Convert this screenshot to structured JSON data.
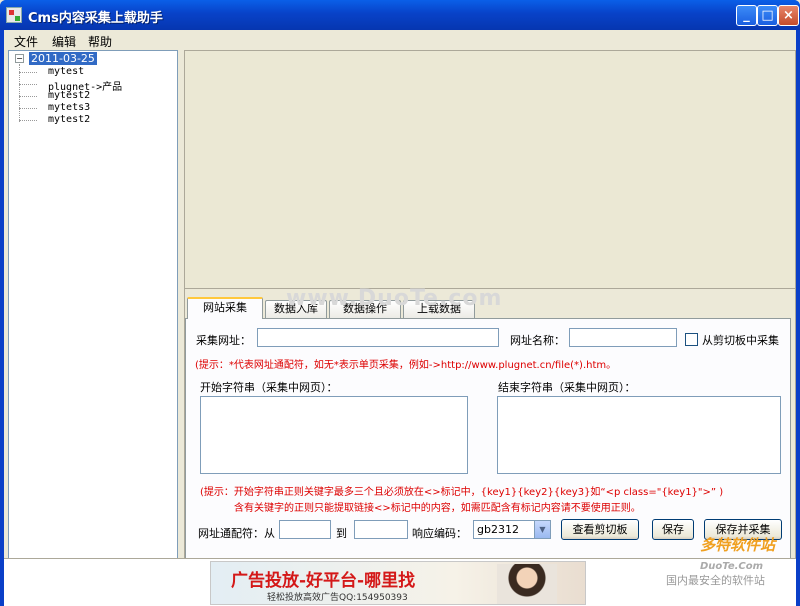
{
  "window": {
    "title": "Cms内容采集上载助手",
    "minimize": "_",
    "maximize": "□",
    "close": "×"
  },
  "menu": {
    "file": "文件",
    "edit": "编辑",
    "help": "帮助"
  },
  "tree": {
    "toggle": "−",
    "root": "2011-03-25",
    "children": [
      "mytest",
      "plugnet->产品",
      "mytest2",
      "mytets3",
      "mytest2"
    ]
  },
  "tabs": [
    "网站采集",
    "数据入库",
    "数据操作",
    "上载数据"
  ],
  "form": {
    "url_label": "采集网址：",
    "url_value": "",
    "site_name_label": "网址名称：",
    "site_name_value": "",
    "clipboard_check_label": "从剪切板中采集",
    "hint1": "(提示：*代表网址通配符，如无*表示单页采集，例如->http://www.plugnet.cn/file(*).htm。",
    "start_label": "开始字符串（采集中网页）：",
    "end_label": "结束字符串（采集中网页）：",
    "hint2_line1": "(提示：开始字符串正则关键字最多三个且必须放在<>标记中，{key1}{key2}{key3}如“<p class=\"{key1}\">” )",
    "hint2_line2": "含有关键字的正则只能提取链接<>标记中的内容，如需匹配含有标记内容请不要使用正则。",
    "wildcard_label": "网址通配符：从",
    "from_value": "",
    "to_label": "到",
    "to_value": "",
    "encoding_label": "响应编码：",
    "encoding_value": "gb2312",
    "view_clipboard_button": "查看剪切板",
    "save_button": "保存",
    "save_collect_button": "保存并采集"
  },
  "ad": {
    "headline": "广告投放-好平台-哪里找",
    "subline": "轻松投放高效广告QQ:154950393"
  },
  "watermarks": {
    "center": "www.DuoTe.com",
    "brand": "多特软件站",
    "site": "DuoTe.Com",
    "tagline": "国内最安全的软件站"
  }
}
